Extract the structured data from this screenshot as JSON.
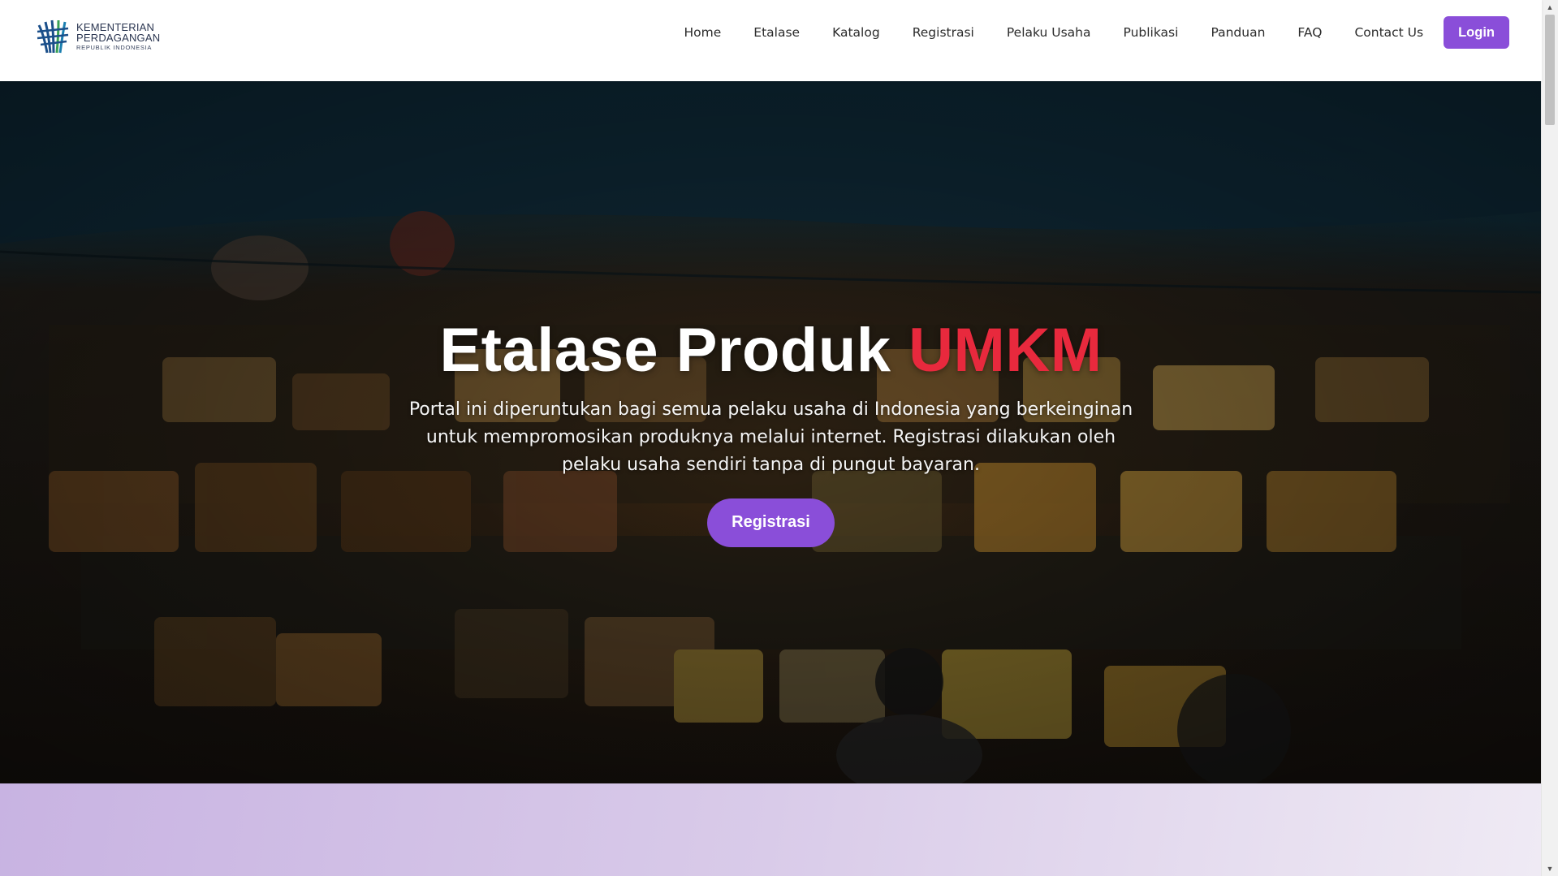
{
  "logo": {
    "line1": "KEMENTERIAN",
    "line2": "PERDAGANGAN",
    "line3": "REPUBLIK INDONESIA"
  },
  "nav": {
    "items": [
      "Home",
      "Etalase",
      "Katalog",
      "Registrasi",
      "Pelaku Usaha",
      "Publikasi",
      "Panduan",
      "FAQ",
      "Contact Us"
    ],
    "login_label": "Login"
  },
  "hero": {
    "title_main": "Etalase Produk",
    "title_accent": "UMKM",
    "description": "Portal ini diperuntukan bagi semua pelaku usaha di Indonesia yang berkeinginan untuk mempromosikan produknya melalui internet. Registrasi dilakukan oleh pelaku usaha sendiri tanpa di pungut bayaran.",
    "cta_label": "Registrasi"
  },
  "colors": {
    "accent_purple": "#8a4ed9",
    "accent_red": "#e8293d",
    "band_purple": "#c8b3e2"
  },
  "icons": {
    "scroll_up": "▲",
    "scroll_down": "▼"
  }
}
